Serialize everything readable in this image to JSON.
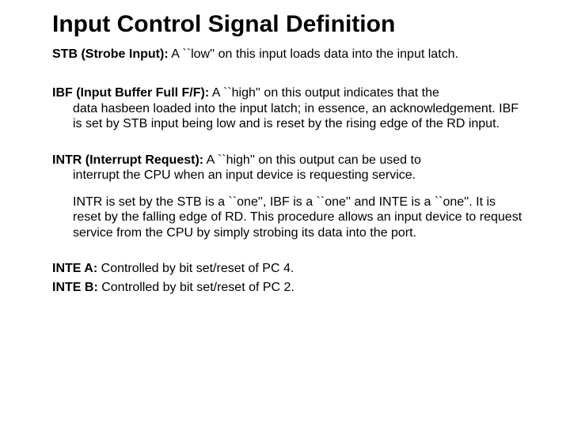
{
  "title": "Input Control Signal Definition",
  "stb": {
    "sig": "STB (Strobe Input):",
    "l1": " A ``low'' on this input loads data into the input latch."
  },
  "ibf": {
    "sig": "IBF (Input Buffer Full F/F):",
    "l1": " A ``high'' on this output indicates that the",
    "cont": "data hasbeen loaded into the input latch; in essence, an acknowledgement. IBF is set by STB input being low and is reset by the rising edge of the RD input."
  },
  "intr": {
    "sig": "INTR (Interrupt Request):",
    "l1": " A ``high'' on this output can be used to",
    "cont1": "interrupt the CPU when an input device is requesting service.",
    "cont2": "INTR is set by the STB is a ``one'', IBF is a ``one'' and INTE is a ``one''. It is reset by the falling edge of RD. This procedure allows an input device to request service from the CPU by simply strobing its data into the port."
  },
  "inte_a": {
    "sig": "INTE A:",
    "txt": " Controlled by bit set/reset of PC 4."
  },
  "inte_b": {
    "sig": "INTE B:",
    "txt": " Controlled by bit set/reset of PC 2."
  }
}
